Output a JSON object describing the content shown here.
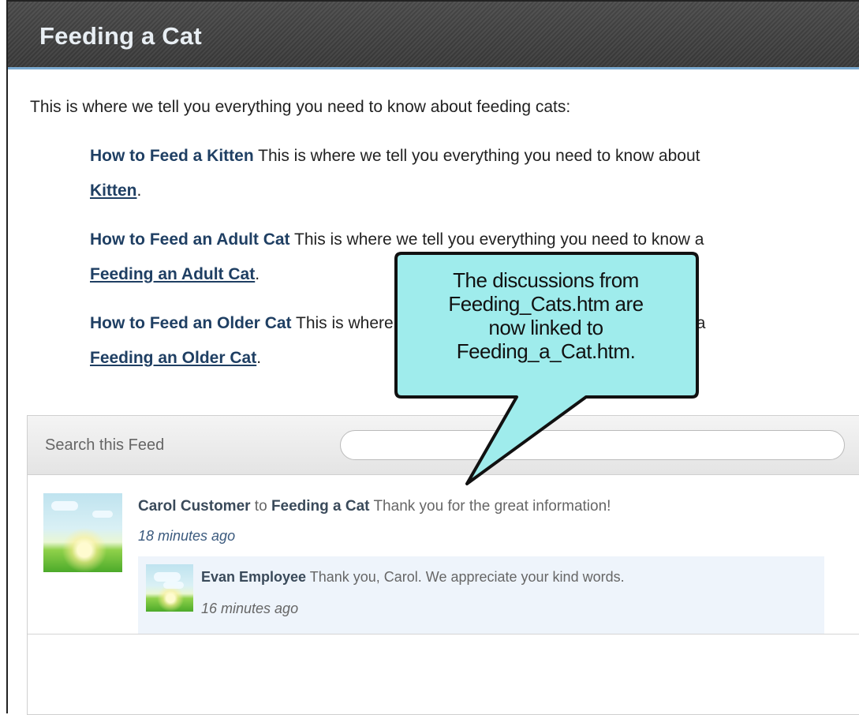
{
  "page": {
    "title": "Feeding a Cat",
    "intro": "This is where we tell you everything you need to know about feeding cats:"
  },
  "topics": [
    {
      "title": "How to Feed a Kitten",
      "text": " This is where we tell you everything you need to know about",
      "link": "Kitten"
    },
    {
      "title": "How to Feed an Adult Cat",
      "text": " This is where we tell you everything you need to know a",
      "link": "Feeding an Adult Cat"
    },
    {
      "title": "How to Feed an Older Cat",
      "text": " This is where we tell you everything you need to know a",
      "link": "Feeding an Older Cat"
    }
  ],
  "feed": {
    "search_label": "Search this Feed",
    "search_value": "",
    "post": {
      "author": "Carol Customer",
      "connector": " to ",
      "target": "Feeding a Cat",
      "message": " Thank you for the great information!",
      "time": "18 minutes ago"
    },
    "reply": {
      "author": "Evan Employee",
      "message": " Thank you, Carol. We appreciate your kind words.",
      "time": "16 minutes ago"
    }
  },
  "callout": {
    "line1": "The discussions from",
    "line2": "Feeding_Cats.htm are",
    "line3": "now linked to",
    "line4": "Feeding_a_Cat.htm.",
    "fill": "#9fecec"
  }
}
